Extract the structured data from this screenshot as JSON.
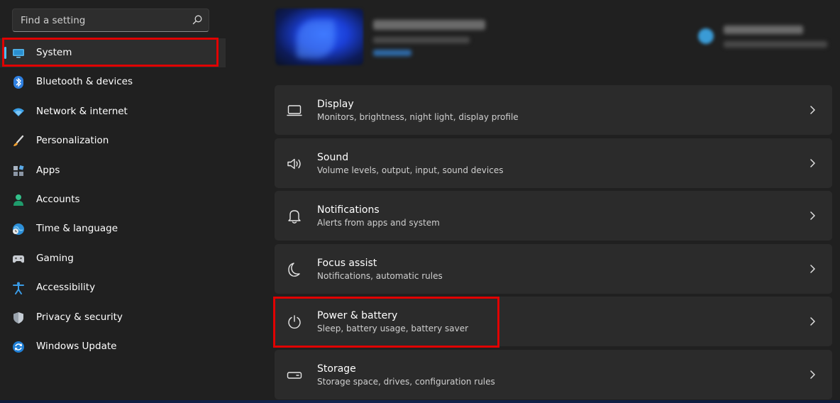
{
  "search": {
    "placeholder": "Find a setting"
  },
  "sidebar": {
    "items": [
      {
        "label": "System",
        "icon": "monitor-icon",
        "active": true
      },
      {
        "label": "Bluetooth & devices",
        "icon": "bluetooth-icon"
      },
      {
        "label": "Network & internet",
        "icon": "wifi-icon"
      },
      {
        "label": "Personalization",
        "icon": "brush-icon"
      },
      {
        "label": "Apps",
        "icon": "apps-icon"
      },
      {
        "label": "Accounts",
        "icon": "person-icon"
      },
      {
        "label": "Time & language",
        "icon": "globe-clock-icon"
      },
      {
        "label": "Gaming",
        "icon": "gamepad-icon"
      },
      {
        "label": "Accessibility",
        "icon": "accessibility-icon"
      },
      {
        "label": "Privacy & security",
        "icon": "shield-icon"
      },
      {
        "label": "Windows Update",
        "icon": "update-icon"
      }
    ]
  },
  "cards": [
    {
      "title": "Display",
      "description": "Monitors, brightness, night light, display profile",
      "icon": "display-icon"
    },
    {
      "title": "Sound",
      "description": "Volume levels, output, input, sound devices",
      "icon": "speaker-icon"
    },
    {
      "title": "Notifications",
      "description": "Alerts from apps and system",
      "icon": "bell-icon"
    },
    {
      "title": "Focus assist",
      "description": "Notifications, automatic rules",
      "icon": "moon-icon"
    },
    {
      "title": "Power & battery",
      "description": "Sleep, battery usage, battery saver",
      "icon": "power-icon"
    },
    {
      "title": "Storage",
      "description": "Storage space, drives, configuration rules",
      "icon": "storage-icon"
    }
  ],
  "colors": {
    "accent": "#4cc2ff",
    "highlight": "#e00000",
    "background": "#202020",
    "card": "#2b2b2b"
  }
}
